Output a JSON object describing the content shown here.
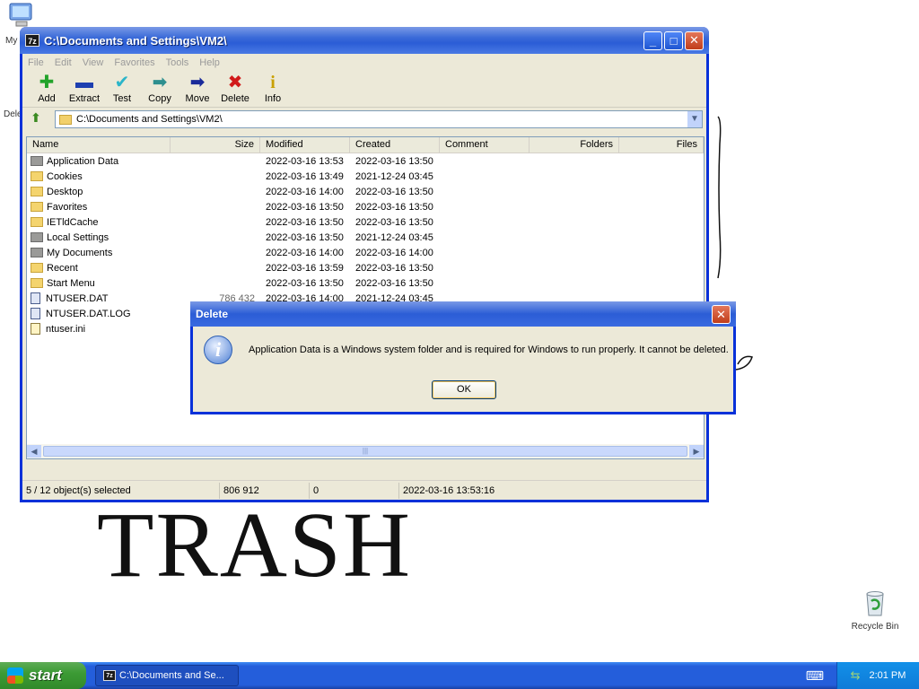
{
  "desktop": {
    "mycomputer_label": "My",
    "partial_label": "Dele",
    "recycle_label": "Recycle Bin",
    "trash_text": "TRASH"
  },
  "window": {
    "app_icon": "7z",
    "title": "C:\\Documents and Settings\\VM2\\",
    "menu": [
      "File",
      "Edit",
      "View",
      "Favorites",
      "Tools",
      "Help"
    ],
    "toolbar": [
      {
        "label": "Add",
        "icon": "plus-icon"
      },
      {
        "label": "Extract",
        "icon": "minus-icon"
      },
      {
        "label": "Test",
        "icon": "check-icon"
      },
      {
        "label": "Copy",
        "icon": "copy-arrow-icon"
      },
      {
        "label": "Move",
        "icon": "move-arrow-icon"
      },
      {
        "label": "Delete",
        "icon": "delete-x-icon"
      },
      {
        "label": "Info",
        "icon": "info-icon"
      }
    ],
    "address": "C:\\Documents and Settings\\VM2\\",
    "columns": [
      "Name",
      "Size",
      "Modified",
      "Created",
      "Comment",
      "Folders",
      "Files"
    ],
    "rows": [
      {
        "name": "Application Data",
        "size": "",
        "modified": "2022-03-16 13:53",
        "created": "2022-03-16 13:50",
        "type": "sysfolder"
      },
      {
        "name": "Cookies",
        "size": "",
        "modified": "2022-03-16 13:49",
        "created": "2021-12-24 03:45",
        "type": "folder"
      },
      {
        "name": "Desktop",
        "size": "",
        "modified": "2022-03-16 14:00",
        "created": "2022-03-16 13:50",
        "type": "folder"
      },
      {
        "name": "Favorites",
        "size": "",
        "modified": "2022-03-16 13:50",
        "created": "2022-03-16 13:50",
        "type": "folder"
      },
      {
        "name": "IETldCache",
        "size": "",
        "modified": "2022-03-16 13:50",
        "created": "2022-03-16 13:50",
        "type": "folder"
      },
      {
        "name": "Local Settings",
        "size": "",
        "modified": "2022-03-16 13:50",
        "created": "2021-12-24 03:45",
        "type": "sysfolder"
      },
      {
        "name": "My Documents",
        "size": "",
        "modified": "2022-03-16 14:00",
        "created": "2022-03-16 14:00",
        "type": "sysfolder"
      },
      {
        "name": "Recent",
        "size": "",
        "modified": "2022-03-16 13:59",
        "created": "2022-03-16 13:50",
        "type": "folder"
      },
      {
        "name": "Start Menu",
        "size": "",
        "modified": "2022-03-16 13:50",
        "created": "2022-03-16 13:50",
        "type": "folder"
      },
      {
        "name": "NTUSER.DAT",
        "size": "786 432",
        "modified": "2022-03-16 14:00",
        "created": "2021-12-24 03:45",
        "type": "doc"
      },
      {
        "name": "NTUSER.DAT.LOG",
        "size": "",
        "modified": "",
        "created": "",
        "type": "doc"
      },
      {
        "name": "ntuser.ini",
        "size": "",
        "modified": "",
        "created": "",
        "type": "ini"
      }
    ],
    "status": {
      "selected": "5 / 12 object(s) selected",
      "size": "806 912",
      "packed": "0",
      "date": "2022-03-16 13:53:16"
    }
  },
  "dialog": {
    "title": "Delete",
    "message": "Application Data is a Windows system folder and is required for Windows to run properly. It cannot be deleted.",
    "ok_label": "OK"
  },
  "taskbar": {
    "start_label": "start",
    "task_label": "C:\\Documents and Se...",
    "clock": "2:01 PM"
  }
}
